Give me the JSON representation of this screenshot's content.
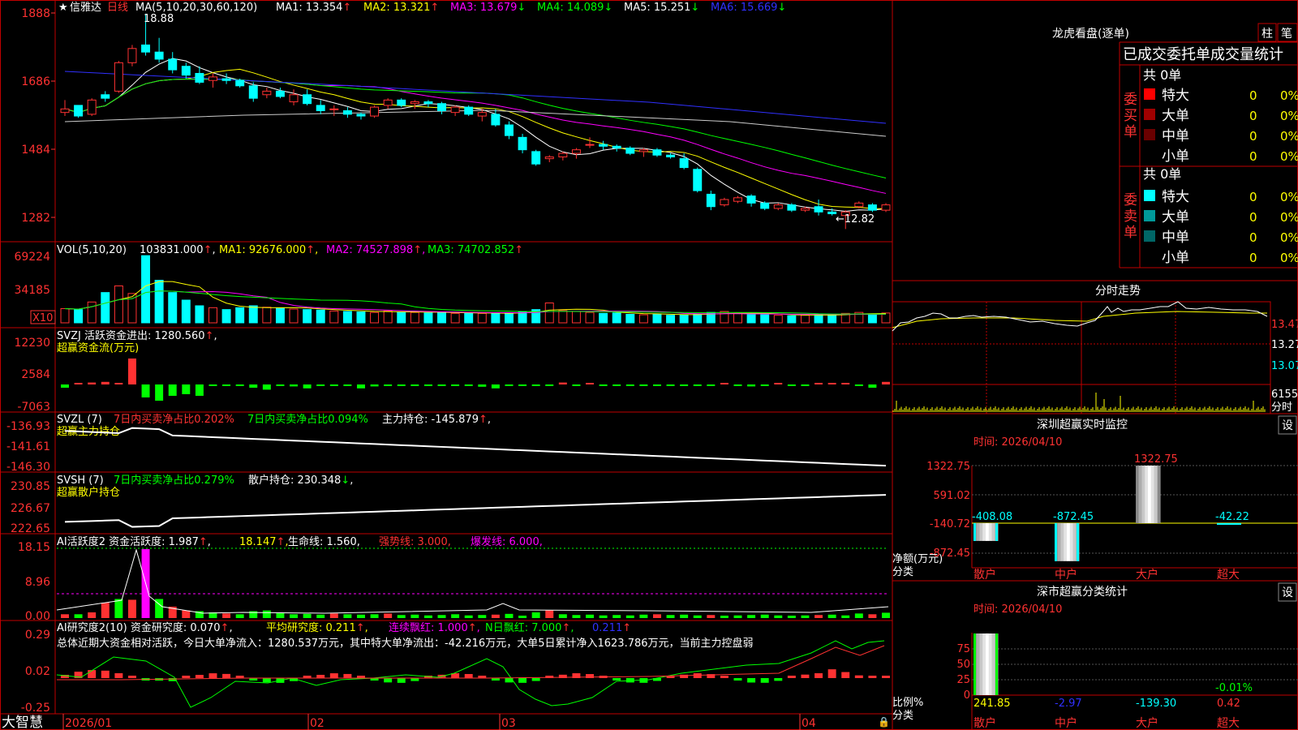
{
  "colors": {
    "bg": "#000000",
    "frame": "#c00000",
    "up": "#ff3232",
    "down": "#00ffff",
    "green": "#00ff00",
    "yellow": "#ffff00",
    "magenta": "#ff00ff",
    "white": "#ffffff",
    "axisRed": "#ff3232",
    "blue": "#3030ff"
  },
  "brand": "大智慧",
  "time_axis": [
    "2026/01",
    "02",
    "03",
    "04"
  ],
  "main": {
    "header_star": "★",
    "stock_name": "信雅达",
    "period": "日线",
    "ma_spec": "MA(5,10,20,30,60,120)",
    "ma_values": [
      {
        "label": "MA1:",
        "value": "13.354",
        "arrow": "↑"
      },
      {
        "label": "MA2:",
        "value": "13.321",
        "arrow": "↑"
      },
      {
        "label": "MA3:",
        "value": "13.679",
        "arrow": "↓"
      },
      {
        "label": "MA4:",
        "value": "14.089",
        "arrow": "↓"
      },
      {
        "label": "MA5:",
        "value": "15.251",
        "arrow": "↓"
      },
      {
        "label": "MA6:",
        "value": "15.669",
        "arrow": "↓"
      }
    ],
    "y_ticks": [
      "1888",
      "1686",
      "1484",
      "1282"
    ],
    "high_label": "18.88",
    "low_label": "←12.82"
  },
  "vol": {
    "title": "VOL(5,10,20)",
    "value": "103831.000",
    "ma1": "MA1: 92676.000",
    "ma2": "MA2: 74527.898",
    "ma3": "MA3: 74702.852",
    "y_ticks": [
      "69224",
      "34185"
    ],
    "unit": "X10"
  },
  "svzj": {
    "title": "SVZJ  活跃资金进出: 1280.560",
    "subtitle": "超赢资金流(万元)",
    "y_ticks": [
      "12230",
      "2584",
      "-7063"
    ]
  },
  "svzl": {
    "title": "SVZL (7)",
    "part1": "7日内买卖净占比0.202%",
    "part2": "7日内买卖净占比0.094%",
    "part3": "主力持仓: -145.879",
    "subtitle": "超赢主力持仓",
    "y_ticks": [
      "-136.93",
      "-141.61",
      "-146.30"
    ]
  },
  "svsh": {
    "title": "SVSH (7)",
    "part1": "7日内买卖净占比0.279%",
    "part2": "散户持仓: 230.348",
    "subtitle": "超赢散户持仓",
    "y_ticks": [
      "230.85",
      "226.67",
      "222.65"
    ]
  },
  "ai1": {
    "title": "AI活跃度2 资金活跃度: 1.987",
    "v2": "18.147",
    "v3": "生命线: 1.560",
    "v4": "强势线: 3.000",
    "v5": "爆发线: 6.000",
    "y_ticks": [
      "18.15",
      "8.96",
      "0.00"
    ]
  },
  "ai2": {
    "title": "AI研究度2(10) 资金研究度: 0.070",
    "v2": "平均研究度: 0.211",
    "v3": "连续飘红: 1.000",
    "v4": "N日飘红: 7.000",
    "v5": "0.211",
    "summary": "总体近期大资金相对活跃，今日大单净流入：1280.537万元，其中特大单净流出：-42.216万元，大单5日累计净入1623.786万元，当前主力控盘弱",
    "y_ticks": [
      "0.29",
      "0.02",
      "-0.25"
    ]
  },
  "lhb": {
    "title": "龙虎看盘(逐单)",
    "btn1": "柱",
    "btn2": "笔",
    "heading": "已成交委托单成交量统计",
    "buy_total": "共 0单",
    "sell_total": "共 0单",
    "buy_label": "委买单",
    "sell_label": "委卖单",
    "buy_rows": [
      {
        "name": "特大",
        "count": "0",
        "pct": "0%",
        "color": "#ff0000"
      },
      {
        "name": "大单",
        "count": "0",
        "pct": "0%",
        "color": "#a00000"
      },
      {
        "name": "中单",
        "count": "0",
        "pct": "0%",
        "color": "#6a0000"
      },
      {
        "name": "小单",
        "count": "0",
        "pct": "0%",
        "color": "#000000"
      }
    ],
    "sell_rows": [
      {
        "name": "特大",
        "count": "0",
        "pct": "0%",
        "color": "#00ffff"
      },
      {
        "name": "大单",
        "count": "0",
        "pct": "0%",
        "color": "#009999"
      },
      {
        "name": "中单",
        "count": "0",
        "pct": "0%",
        "color": "#006666"
      },
      {
        "name": "小单",
        "count": "0",
        "pct": "0%",
        "color": "#000000"
      }
    ]
  },
  "fenshi": {
    "title": "分时走势",
    "y_ticks": [
      "13.47",
      "13.27",
      "13.07"
    ],
    "vol_tick": "6155",
    "vol_unit": "分时"
  },
  "monitor": {
    "title": "深圳超赢实时监控",
    "btn": "设",
    "time": "时间: 2026/04/10",
    "y_ticks": [
      "1322.75",
      "591.02",
      "-140.72",
      "-872.45"
    ],
    "axis_label1": "净额(万元)",
    "axis_label2": "分类",
    "categories": [
      "散户",
      "中户",
      "大户",
      "超大"
    ],
    "values": [
      -408.08,
      -872.45,
      1322.75,
      -42.22
    ],
    "value_labels": [
      "-408.08",
      "-872.45",
      "1322.75",
      "-42.22"
    ]
  },
  "classify": {
    "title": "深市超赢分类统计",
    "btn": "设",
    "time": "时间: 2026/04/10",
    "y_ticks": [
      "75",
      "50",
      "25",
      "0"
    ],
    "axis_label1": "比例%",
    "axis_label2": "分类",
    "categories": [
      "散户",
      "中户",
      "大户",
      "超大"
    ],
    "values": [
      241.85,
      -2.97,
      -139.3,
      0.42
    ],
    "value_labels": [
      "241.85",
      "-2.97",
      "-139.30",
      "0.42"
    ],
    "extra_label": "-0.01%"
  },
  "chart_data": [
    {
      "type": "candlestick",
      "title": "信雅达 日线",
      "x_labels": [
        "2026/01",
        "02",
        "03",
        "04"
      ],
      "ohlc": [
        [
          16.1,
          16.45,
          16.0,
          16.2
        ],
        [
          16.3,
          16.3,
          15.95,
          16.0
        ],
        [
          16.05,
          16.5,
          16.0,
          16.45
        ],
        [
          16.6,
          16.7,
          16.4,
          16.5
        ],
        [
          16.7,
          17.55,
          16.65,
          17.5
        ],
        [
          17.5,
          18.0,
          17.4,
          17.9
        ],
        [
          18.0,
          18.88,
          17.7,
          17.8
        ],
        [
          17.8,
          18.2,
          17.5,
          17.6
        ],
        [
          17.6,
          17.8,
          17.2,
          17.3
        ],
        [
          17.4,
          17.5,
          17.05,
          17.15
        ],
        [
          17.2,
          17.4,
          16.9,
          16.95
        ],
        [
          17.0,
          17.2,
          16.8,
          17.1
        ],
        [
          17.05,
          17.2,
          16.9,
          17.0
        ],
        [
          17.0,
          17.05,
          16.8,
          16.85
        ],
        [
          16.85,
          16.95,
          16.4,
          16.5
        ],
        [
          16.6,
          16.8,
          16.5,
          16.7
        ],
        [
          16.7,
          16.8,
          16.5,
          16.55
        ],
        [
          16.4,
          16.75,
          16.3,
          16.6
        ],
        [
          16.6,
          16.75,
          16.3,
          16.35
        ],
        [
          16.3,
          16.45,
          16.05,
          16.15
        ],
        [
          16.2,
          16.3,
          16.0,
          16.2
        ],
        [
          16.15,
          16.25,
          15.95,
          16.05
        ],
        [
          16.05,
          16.1,
          15.9,
          16.0
        ],
        [
          16.0,
          16.3,
          15.95,
          16.25
        ],
        [
          16.3,
          16.5,
          16.2,
          16.45
        ],
        [
          16.45,
          16.5,
          16.25,
          16.3
        ],
        [
          16.35,
          16.45,
          16.2,
          16.4
        ],
        [
          16.4,
          16.45,
          16.25,
          16.35
        ],
        [
          16.35,
          16.4,
          16.05,
          16.15
        ],
        [
          16.1,
          16.3,
          16.0,
          16.25
        ],
        [
          16.25,
          16.3,
          16.0,
          16.05
        ],
        [
          16.0,
          16.2,
          15.85,
          16.1
        ],
        [
          16.05,
          16.2,
          15.7,
          15.75
        ],
        [
          15.75,
          15.85,
          15.35,
          15.45
        ],
        [
          15.4,
          15.5,
          14.95,
          15.05
        ],
        [
          15.0,
          15.05,
          14.6,
          14.65
        ],
        [
          14.8,
          14.9,
          14.7,
          14.85
        ],
        [
          14.85,
          15.0,
          14.75,
          14.95
        ],
        [
          14.95,
          15.1,
          14.8,
          15.05
        ],
        [
          15.2,
          15.4,
          15.1,
          15.2
        ],
        [
          15.2,
          15.3,
          15.05,
          15.15
        ],
        [
          15.15,
          15.2,
          15.0,
          15.1
        ],
        [
          15.1,
          15.15,
          14.9,
          14.95
        ],
        [
          15.0,
          15.1,
          14.85,
          15.05
        ],
        [
          15.05,
          15.1,
          14.85,
          14.9
        ],
        [
          14.9,
          14.95,
          14.8,
          14.85
        ],
        [
          14.8,
          14.95,
          14.5,
          14.55
        ],
        [
          14.5,
          14.55,
          13.85,
          13.9
        ],
        [
          13.8,
          13.9,
          13.35,
          13.45
        ],
        [
          13.5,
          13.7,
          13.45,
          13.65
        ],
        [
          13.6,
          13.75,
          13.55,
          13.7
        ],
        [
          13.75,
          13.8,
          13.45,
          13.55
        ],
        [
          13.55,
          13.6,
          13.35,
          13.4
        ],
        [
          13.4,
          13.55,
          13.35,
          13.5
        ],
        [
          13.5,
          13.55,
          13.3,
          13.35
        ],
        [
          13.35,
          13.45,
          13.3,
          13.4
        ],
        [
          13.45,
          13.65,
          13.2,
          13.3
        ],
        [
          13.3,
          13.4,
          13.2,
          13.25
        ],
        [
          13.2,
          13.35,
          12.82,
          13.3
        ],
        [
          13.45,
          13.6,
          13.4,
          13.55
        ],
        [
          13.5,
          13.55,
          13.3,
          13.35
        ],
        [
          13.35,
          13.55,
          13.3,
          13.5
        ]
      ],
      "ylim": [
        12.6,
        18.9
      ]
    },
    {
      "type": "bar",
      "title": "VOL(5,10,20)",
      "values": [
        15000,
        14000,
        22000,
        32000,
        39000,
        31000,
        71000,
        45000,
        32000,
        24000,
        18000,
        16000,
        14000,
        16000,
        18000,
        16500,
        15500,
        14500,
        14000,
        13500,
        12500,
        12000,
        11500,
        11000,
        12500,
        11500,
        11000,
        10500,
        11000,
        10000,
        10500,
        10000,
        10500,
        9500,
        12000,
        14000,
        21000,
        13000,
        12000,
        11000,
        10000,
        10500,
        9000,
        8500,
        9500,
        8000,
        8500,
        9000,
        11000,
        12000,
        10000,
        9000,
        8500,
        8000,
        7500,
        8000,
        9000,
        8500,
        10000,
        11000,
        9500,
        10383
      ]
    },
    {
      "type": "line",
      "title": "SVZL 主力持仓",
      "ylim": [
        -146.3,
        -136.93
      ]
    },
    {
      "type": "line",
      "title": "SVSH 散户持仓",
      "ylim": [
        222.65,
        230.85
      ]
    },
    {
      "type": "bar",
      "title": "深圳超赢实时监控",
      "categories": [
        "散户",
        "中户",
        "大户",
        "超大"
      ],
      "values": [
        -408.08,
        -872.45,
        1322.75,
        -42.22
      ],
      "ylim": [
        -872.45,
        1322.75
      ]
    },
    {
      "type": "bar",
      "title": "深市超赢分类统计",
      "categories": [
        "散户",
        "中户",
        "大户",
        "超大"
      ],
      "values": [
        241.85,
        -2.97,
        -139.3,
        0.42
      ]
    }
  ]
}
